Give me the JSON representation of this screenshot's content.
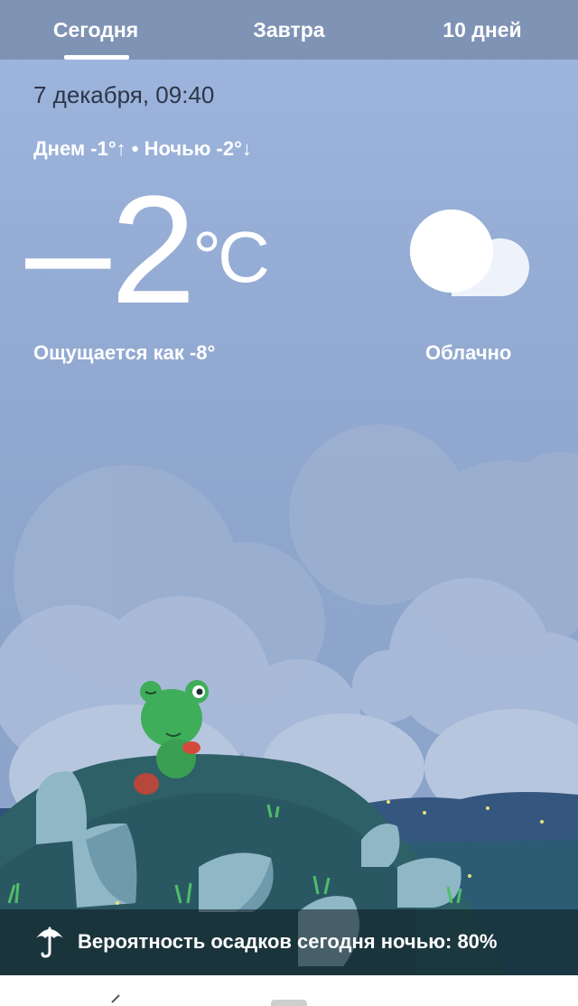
{
  "tabs": [
    {
      "label": "Сегодня",
      "selected": true
    },
    {
      "label": "Завтра",
      "selected": false
    },
    {
      "label": "10 дней",
      "selected": false
    }
  ],
  "weather": {
    "date_time": "7 декабря, 09:40",
    "day_night": "Днем -1°↑ • Ночью -2°↓",
    "temperature_value": "2",
    "temperature_sign": "–",
    "temperature_unit": "°C",
    "feels_like": "Ощущается как -8°",
    "condition": "Облачно",
    "condition_icon": "cloud-icon"
  },
  "precipitation": {
    "text": "Вероятность осадков сегодня ночью: 80%",
    "icon": "umbrella-icon"
  },
  "colors": {
    "tab_bar": "#7f93b5",
    "sky": "#94acd4",
    "text_dark": "#2d3647",
    "frog": "#3fae5a"
  }
}
